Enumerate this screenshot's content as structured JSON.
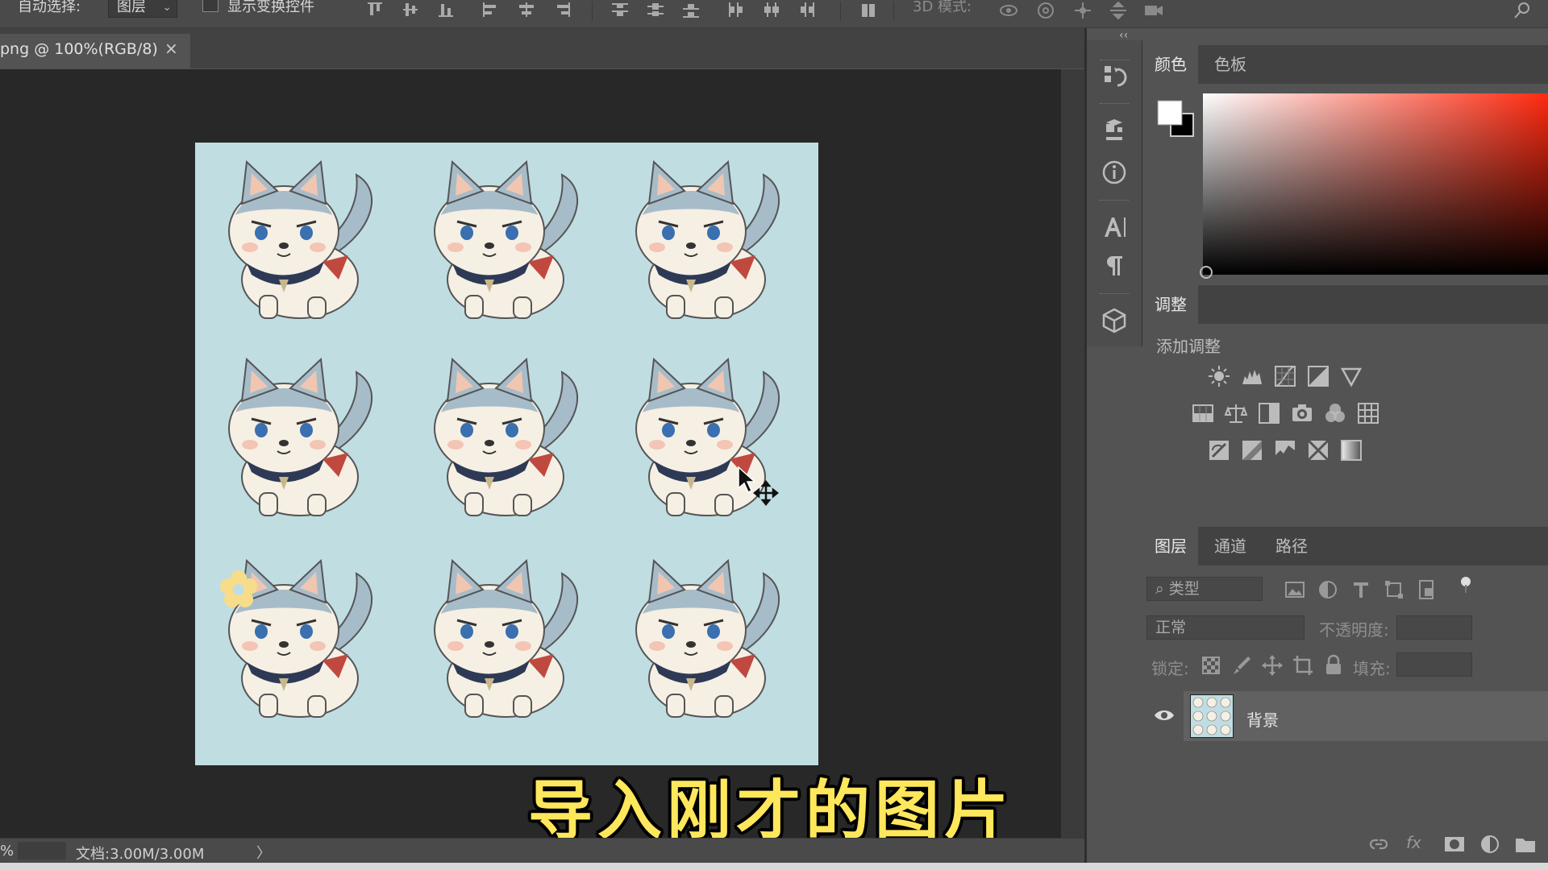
{
  "options_bar": {
    "auto_select_label": "自动选择:",
    "auto_select_value": "图层",
    "show_transform_label": "显示变换控件",
    "mode_3d_label": "3D 模式:"
  },
  "document": {
    "tab_title": "png @ 100%(RGB/8)",
    "close_glyph": "×"
  },
  "status_bar": {
    "zoom": "%",
    "doc_size": "文档:3.00M/3.00M",
    "arrow": "〉"
  },
  "color_panel": {
    "tabs": [
      "颜色",
      "色板"
    ],
    "foreground": "#ffffff",
    "background": "#000000"
  },
  "adjustments_panel": {
    "title": "调整",
    "add_label": "添加调整",
    "icons_row1": [
      "brightness-icon",
      "levels-icon",
      "curves-icon",
      "exposure-icon",
      "vibrance-icon"
    ],
    "icons_row2": [
      "hue-saturation-icon",
      "color-balance-icon",
      "black-white-icon",
      "photo-filter-icon",
      "channel-mixer-icon",
      "color-lookup-icon"
    ],
    "icons_row3": [
      "invert-icon",
      "posterize-icon",
      "threshold-icon",
      "selective-color-icon",
      "gradient-map-icon"
    ]
  },
  "layers_panel": {
    "tabs": [
      "图层",
      "通道",
      "路径"
    ],
    "filter_kind": "类型",
    "blend_mode": "正常",
    "opacity_label": "不透明度:",
    "lock_label": "锁定:",
    "fill_label": "填充:",
    "layers": [
      {
        "name": "背景",
        "visible": true
      }
    ],
    "footer_fx": "fx"
  },
  "subtitle": "导入刚才的图片",
  "colors": {
    "workspace": "#282828",
    "panel": "#535353",
    "artwork_bg": "#c0dde2",
    "subtitle": "#ffe75c"
  }
}
